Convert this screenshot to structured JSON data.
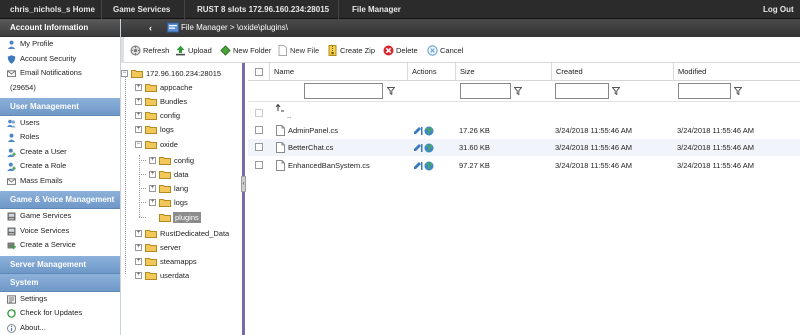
{
  "topnav": {
    "user_home": "chris_nichols_s Home",
    "game_services": "Game Services",
    "server": "RUST 8 slots 172.96.160.234:28015",
    "file_manager": "File Manager",
    "logout": "Log Out"
  },
  "sidebar": {
    "account_header": "Account Information",
    "account_items": [
      "My Profile",
      "Account Security",
      "Email Notifications"
    ],
    "notification_count": "(29654)",
    "user_mgmt_header": "User Management",
    "user_mgmt_items": [
      "Users",
      "Roles",
      "Create a User",
      "Create a Role",
      "Mass Emails"
    ],
    "game_voice_header": "Game & Voice Management",
    "game_voice_items": [
      "Game Services",
      "Voice Services",
      "Create a Service"
    ],
    "server_mgmt_header": "Server Management",
    "system_header": "System",
    "system_items": [
      "Settings",
      "Check for Updates",
      "About..."
    ]
  },
  "file_manager": {
    "back_glyph": "‹",
    "breadcrumb": "File Manager > \\oxide\\plugins\\"
  },
  "toolbar": {
    "refresh": "Refresh",
    "upload": "Upload",
    "new_folder": "New Folder",
    "new_file": "New File",
    "create_zip": "Create Zip",
    "delete": "Delete",
    "cancel": "Cancel"
  },
  "tree": {
    "root": "172.96.160.234:28015",
    "nodes": [
      "appcache",
      "Bundles",
      "config",
      "logs",
      "oxide",
      "RustDedicated_Data",
      "server",
      "steamapps",
      "userdata"
    ],
    "oxide_children": [
      "config",
      "data",
      "lang",
      "logs",
      "plugins"
    ],
    "selected": "plugins"
  },
  "grid": {
    "columns": {
      "name": "Name",
      "actions": "Actions",
      "size": "Size",
      "created": "Created",
      "modified": "Modified"
    },
    "up_label": "..",
    "files": [
      {
        "name": "AdminPanel.cs",
        "size": "17.26 KB",
        "created": "3/24/2018 11:55:46 AM",
        "modified": "3/24/2018 11:55:46 AM"
      },
      {
        "name": "BetterChat.cs",
        "size": "31.60 KB",
        "created": "3/24/2018 11:55:46 AM",
        "modified": "3/24/2018 11:55:46 AM"
      },
      {
        "name": "EnhancedBanSystem.cs",
        "size": "97.27 KB",
        "created": "3/24/2018 11:55:46 AM",
        "modified": "3/24/2018 11:55:46 AM"
      }
    ]
  },
  "colors": {
    "topbar": "#2b2b2b",
    "section_blue": "#7ba2d0",
    "section_dark": "#4a4a4a",
    "row_alt": "#f1f5fb",
    "splitter": "#7b6aa8",
    "folder": "#f2c85b"
  },
  "icons": {
    "folder": "folder-icon",
    "file": "document-icon",
    "filter": "filter-icon",
    "refresh": "refresh-icon",
    "upload": "upload-icon",
    "new_folder": "new-folder-icon",
    "new_file": "new-file-icon",
    "zip": "zip-icon",
    "delete": "delete-icon",
    "cancel": "cancel-icon",
    "edit": "edit-icon",
    "globe": "globe-icon"
  }
}
